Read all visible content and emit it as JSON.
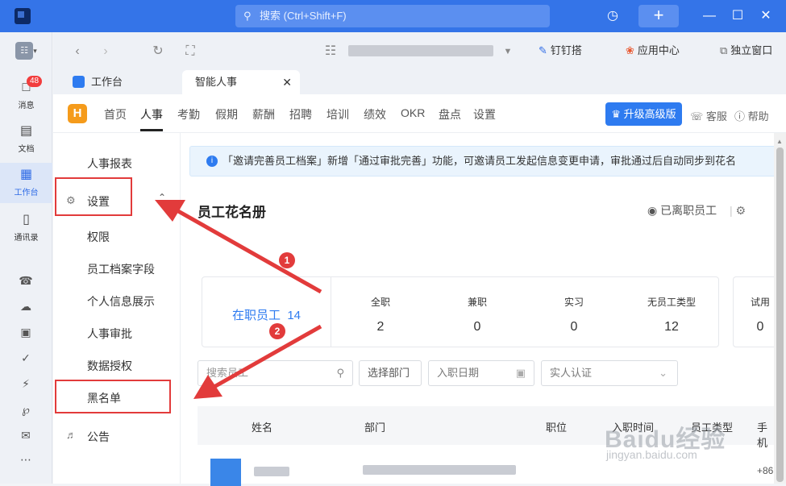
{
  "titlebar": {
    "search_placeholder": "搜索 (Ctrl+Shift+F)",
    "plus": "+",
    "history_icon": "history-icon"
  },
  "leftnav": {
    "items": [
      {
        "label": "消息",
        "icon": "chat-icon",
        "badge": "48"
      },
      {
        "label": "文档",
        "icon": "doc-icon"
      },
      {
        "label": "工作台",
        "icon": "grid-icon"
      },
      {
        "label": "通讯录",
        "icon": "contacts-icon"
      }
    ]
  },
  "browser": {
    "links": [
      "钉钉搭",
      "应用中心",
      "独立窗口"
    ]
  },
  "tabs": [
    "工作台",
    "智能人事"
  ],
  "app": {
    "menu": [
      "首页",
      "人事",
      "考勤",
      "假期",
      "薪酬",
      "招聘",
      "培训",
      "绩效",
      "OKR",
      "盘点",
      "设置"
    ],
    "upgrade": "升级高级版",
    "service": "客服",
    "help": "帮助"
  },
  "sidenav": {
    "report": "人事报表",
    "settings": "设置",
    "items": [
      "权限",
      "员工档案字段",
      "个人信息展示",
      "人事审批",
      "数据授权",
      "黑名单"
    ],
    "notice": "公告"
  },
  "main": {
    "notice": "「邀请完善员工档案」新增「通过审批完善」功能，可邀请员工发起信息变更申请，审批通过后自动同步到花名",
    "title": "员工花名册",
    "former": "已离职员工",
    "on_job_label": "在职员工",
    "on_job_count": "14",
    "stats": [
      {
        "label": "全职",
        "value": "2"
      },
      {
        "label": "兼职",
        "value": "0"
      },
      {
        "label": "实习",
        "value": "0"
      },
      {
        "label": "无员工类型",
        "value": "12"
      }
    ],
    "stats2": [
      {
        "label": "试用",
        "value": "0"
      }
    ],
    "filters": {
      "search": "搜索员工",
      "dept": "选择部门",
      "date": "入职日期",
      "verify": "实人认证"
    },
    "columns": [
      "姓名",
      "部门",
      "职位",
      "入职时间",
      "员工类型",
      "手机"
    ],
    "row_phone": "+86"
  },
  "annotations": {
    "n1": "1",
    "n2": "2"
  },
  "watermark": {
    "brand": "Baidu经验",
    "url": "jingyan.baidu.com"
  },
  "colors": {
    "primary": "#3474e8",
    "accent_red": "#e23b3b",
    "brand_orange": "#f59b1b"
  }
}
